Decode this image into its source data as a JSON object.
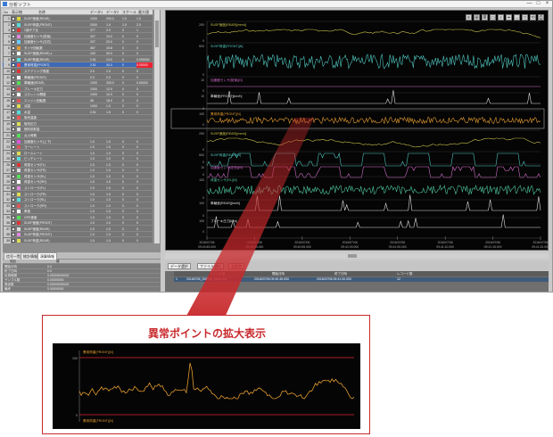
{
  "window": {
    "title": "分析ソフト",
    "min": "—",
    "max": "□",
    "close": "×"
  },
  "table": {
    "headers": [
      "No",
      "表示",
      "線",
      "名称",
      "データ1",
      "データ2",
      "スケール",
      "最小値",
      "最大値",
      "単位"
    ],
    "rows": [
      {
        "no": "1",
        "color": "#d8d83a",
        "name": "SUSP速度(REAR)",
        "v1": "1000",
        "v2": "200.0",
        "v3": "1.0",
        "v4": "1.0"
      },
      {
        "no": "2",
        "color": "#5dd",
        "name": "SUSP荷重(FRONT)",
        "v1": "2000",
        "v2": "1.0",
        "v3": "1.0",
        "v4": "2.0"
      },
      {
        "no": "3",
        "color": "#d33",
        "name": "1速ギア比",
        "v1": "377",
        "v2": "2.0",
        "v3": "0",
        "v4": "1"
      },
      {
        "no": "4",
        "color": "#d8d",
        "name": "加速度センサ(前後)",
        "v1": "207",
        "v2": "10.0",
        "v3": "0",
        "v4": "0"
      },
      {
        "no": "5",
        "color": "#6cf",
        "name": "加速度センサ(左右)",
        "v1": "207",
        "v2": "20.0",
        "v3": "0",
        "v4": "0"
      },
      {
        "no": "6",
        "color": "#d93",
        "name": "タイヤ回転数",
        "v1": "357",
        "v2": "15.8",
        "v3": "0",
        "v4": "0"
      },
      {
        "no": "7",
        "color": "#fff",
        "name": "SUSP速度(REAR)-L",
        "v1": "100",
        "v2": "30.0",
        "v3": "0",
        "v4": "0"
      },
      {
        "no": "8",
        "color": "#5dd",
        "name": "SUSP荷重(REAR)",
        "v1": "2.51",
        "v2": "13.0",
        "v3": "0",
        "v4": "0.000000"
      },
      {
        "no": "9",
        "color": "#f44",
        "name": "異常荷重(FRONT)",
        "v1": "2.51",
        "v2": "30.0",
        "v3": "0",
        "v4": "0.00000"
      },
      {
        "no": "10",
        "color": "#d33",
        "name": "ステアリング角度",
        "v1": "2.0",
        "v2": "1.0",
        "v3": "0",
        "v4": "0"
      },
      {
        "no": "11",
        "color": "#fff",
        "name": "車輪速(FRONT)",
        "v1": "2.0",
        "v2": "2.0",
        "v3": "0",
        "v4": "0"
      },
      {
        "no": "12",
        "color": "#5d5",
        "name": "車輪速(REAR)",
        "v1": "1000",
        "v2": "200.0",
        "v3": "0",
        "v4": "0.00000"
      },
      {
        "no": "13",
        "color": "#c55",
        "name": "ブレーキ圧力",
        "v1": "1000",
        "v2": "12.0",
        "v3": "0",
        "v4": "0"
      },
      {
        "no": "14",
        "color": "#fff",
        "name": "スロットル開度",
        "v1": "1000",
        "v2": "10.0",
        "v3": "0",
        "v4": "0"
      },
      {
        "no": "15",
        "color": "#d55",
        "name": "エンジン回転数",
        "v1": "38",
        "v2": "18.0",
        "v3": "0",
        "v4": "0"
      },
      {
        "no": "16",
        "color": "#dd5",
        "name": "油温",
        "v1": "1000",
        "v2": "1.0",
        "v3": "0",
        "v4": "0"
      },
      {
        "no": "17",
        "color": "#5dd",
        "name": "水温",
        "v1": "2.51",
        "v2": "1.5",
        "v3": "0",
        "v4": "0"
      },
      {
        "no": "18",
        "color": "#e55",
        "name": "吸気温度",
        "v1": "",
        "v2": "",
        "v3": "",
        "v4": ""
      },
      {
        "no": "19",
        "color": "#dd5",
        "name": "吸気圧力",
        "v1": "",
        "v2": "",
        "v3": "",
        "v4": ""
      },
      {
        "no": "20",
        "color": "#ddd",
        "name": "燃料噴射量",
        "v1": "",
        "v2": "",
        "v3": "",
        "v4": ""
      },
      {
        "no": "21",
        "color": "#5d5",
        "name": "点火時期",
        "v1": "",
        "v2": "",
        "v3": "",
        "v4": ""
      },
      {
        "no": "22",
        "color": "#d5d",
        "name": "加速度センサ(上下)",
        "v1": "1.0",
        "v2": "1.0",
        "v3": "0",
        "v4": "0"
      },
      {
        "no": "23",
        "color": "#d55",
        "name": "ヨーレート",
        "v1": "1.0",
        "v2": "1.0",
        "v3": "0",
        "v4": "0"
      },
      {
        "no": "24",
        "color": "#dd5",
        "name": "ロールレート",
        "v1": "1.0",
        "v2": "1.0",
        "v3": "0",
        "v4": "0"
      },
      {
        "no": "25",
        "color": "#5dd",
        "name": "ピッチレート",
        "v1": "1.0",
        "v2": "1.0",
        "v3": "0",
        "v4": "0"
      },
      {
        "no": "26",
        "color": "#d33",
        "name": "荷重センサ(FL)",
        "v1": "1.0",
        "v2": "1.0",
        "v3": "0",
        "v4": "0"
      },
      {
        "no": "27",
        "color": "#ddd",
        "name": "荷重センサ(FR)",
        "v1": "1.0",
        "v2": "1.0",
        "v3": "0",
        "v4": "0"
      },
      {
        "no": "28",
        "color": "#5d5",
        "name": "荷重センサ(RL)",
        "v1": "1.0",
        "v2": "1.0",
        "v3": "0",
        "v4": "0"
      },
      {
        "no": "29",
        "color": "#fff",
        "name": "荷重センサ(RR)",
        "v1": "1.0",
        "v2": "1.0",
        "v3": "0",
        "v4": "0"
      },
      {
        "no": "30",
        "color": "#d8d",
        "name": "ストローク(FL)",
        "v1": "1.0",
        "v2": "1.0",
        "v3": "0",
        "v4": "0"
      },
      {
        "no": "31",
        "color": "#dd5",
        "name": "ストローク(FR)",
        "v1": "1.0",
        "v2": "1.0",
        "v3": "0",
        "v4": "0"
      },
      {
        "no": "32",
        "color": "#5dd",
        "name": "ストローク(RL)",
        "v1": "1.0",
        "v2": "1.0",
        "v3": "0",
        "v4": "0"
      },
      {
        "no": "33",
        "color": "#d55",
        "name": "ストローク(RR)",
        "v1": "1.0",
        "v2": "1.0",
        "v3": "0",
        "v4": "0"
      },
      {
        "no": "34",
        "color": "#fff",
        "name": "車速",
        "v1": "1.0",
        "v2": "1.0",
        "v3": "0",
        "v4": "0"
      },
      {
        "no": "35",
        "color": "#5d5",
        "name": "GPS速度",
        "v1": "1.0",
        "v2": "1.0",
        "v3": "0",
        "v4": "0"
      },
      {
        "no": "36",
        "color": "#d33",
        "name": "SUSP速度(FRONT)",
        "v1": "1.0",
        "v2": "1.0",
        "v3": "0",
        "v4": "0"
      },
      {
        "no": "37",
        "color": "#ddd",
        "name": "SUSP速度(REAR)",
        "v1": "1.0",
        "v2": "1.0",
        "v3": "0",
        "v4": "0"
      },
      {
        "no": "38",
        "color": "#d8d",
        "name": "SUSP荷重(FRONT)",
        "v1": "1.0",
        "v2": "1.0",
        "v3": "0",
        "v4": "0"
      },
      {
        "no": "39",
        "color": "#dd5",
        "name": "SUSP荷重(REAR)",
        "v1": "1.0",
        "v2": "1.0",
        "v3": "0",
        "v4": "0"
      }
    ]
  },
  "bottom_tabs": [
    "信号一覧",
    "統計情報",
    "演算情報"
  ],
  "props": {
    "header": [
      "項目",
      "値"
    ],
    "rows": [
      [
        "開始日時",
        "0.0"
      ],
      [
        "終了日時",
        "0.0"
      ],
      [
        "計測時間",
        "0.00000000000"
      ],
      [
        "サンプル数",
        "0.00000000"
      ],
      [
        "周波数",
        "0.00000000000"
      ],
      [
        "備考",
        "0.00000000"
      ]
    ]
  },
  "toolbar_icons": [
    "≡",
    "⊞",
    "≣",
    "▭",
    "⌕",
    "⌖",
    "↔",
    "□",
    "⟲",
    "⎙"
  ],
  "chart": {
    "times": [
      "2016/07/06 09:40:45.000",
      "2016/07/06 09:40:50.000",
      "2016/07/06 09:40:55.000",
      "2016/07/06 09:41:00.000",
      "2016/07/06 09:41:05.000",
      "2016/07/06 09:41:10.000",
      "2016/07/06 09:41:15.000",
      "2016/07/06 09:41:20.000"
    ],
    "channels": [
      {
        "label": "SUSP速度(REAR)[mm/s]",
        "color": "#c9c24a",
        "ymax": "200",
        "ymin": "0"
      },
      {
        "label": "SUSP荷重(FRONT)[N]",
        "color": "#4fc7c0",
        "ymax": "500",
        "ymin": "0"
      },
      {
        "label": "加速度センサ(前後)[G]",
        "color": "#d86fd0",
        "ymax": "10",
        "ymin": "0"
      },
      {
        "label": "車輪速(FRONT)[km/h]",
        "color": "#e0e0e0",
        "ymax": "10",
        "ymin": "0"
      },
      {
        "label": "異常荷重(FRONT)[N]",
        "color": "#e39b2e",
        "ymax": "100",
        "ymin": "0"
      },
      {
        "label": "SUSP速度(REAR)[mm/s]",
        "color": "#c9c24a",
        "ymax": "200",
        "ymin": "0"
      },
      {
        "label": "SUSP荷重(REAR)[N]",
        "color": "#4fc7c0",
        "ymax": "500",
        "ymin": "0"
      },
      {
        "label": "加速度センサ(左右)[G]",
        "color": "#d86fd0",
        "ymax": "10",
        "ymin": "0"
      },
      {
        "label": "荷重センサ(RL)[N]",
        "color": "#4fc7a0",
        "ymax": "100",
        "ymin": "0"
      },
      {
        "label": "車輪速(REAR)[km/h]",
        "color": "#e0e0e0",
        "ymax": "100",
        "ymin": "0"
      },
      {
        "label": "ブレーキ圧力[kPa]",
        "color": "#e0e0e0",
        "ymax": "100",
        "ymin": "0"
      }
    ]
  },
  "buttons": [
    "データ選択",
    "ファイル選択",
    "全削除"
  ],
  "filelist": {
    "header": [
      "",
      "ファイル名",
      "開始日時",
      "終了日時",
      "レコード数"
    ],
    "row": [
      "1",
      "20160706_094045_0001.dat",
      "2016/07/06 09:40:45.000",
      "2016/07/06 09:41:20.000",
      "12"
    ]
  },
  "callout": {
    "title": "異常ポイントの拡大表示",
    "label_top": "異常荷重(FRONT)[N]",
    "label_bottom": "異常荷重(FRONT)[N]",
    "ymax": "100",
    "ymin": "0"
  }
}
